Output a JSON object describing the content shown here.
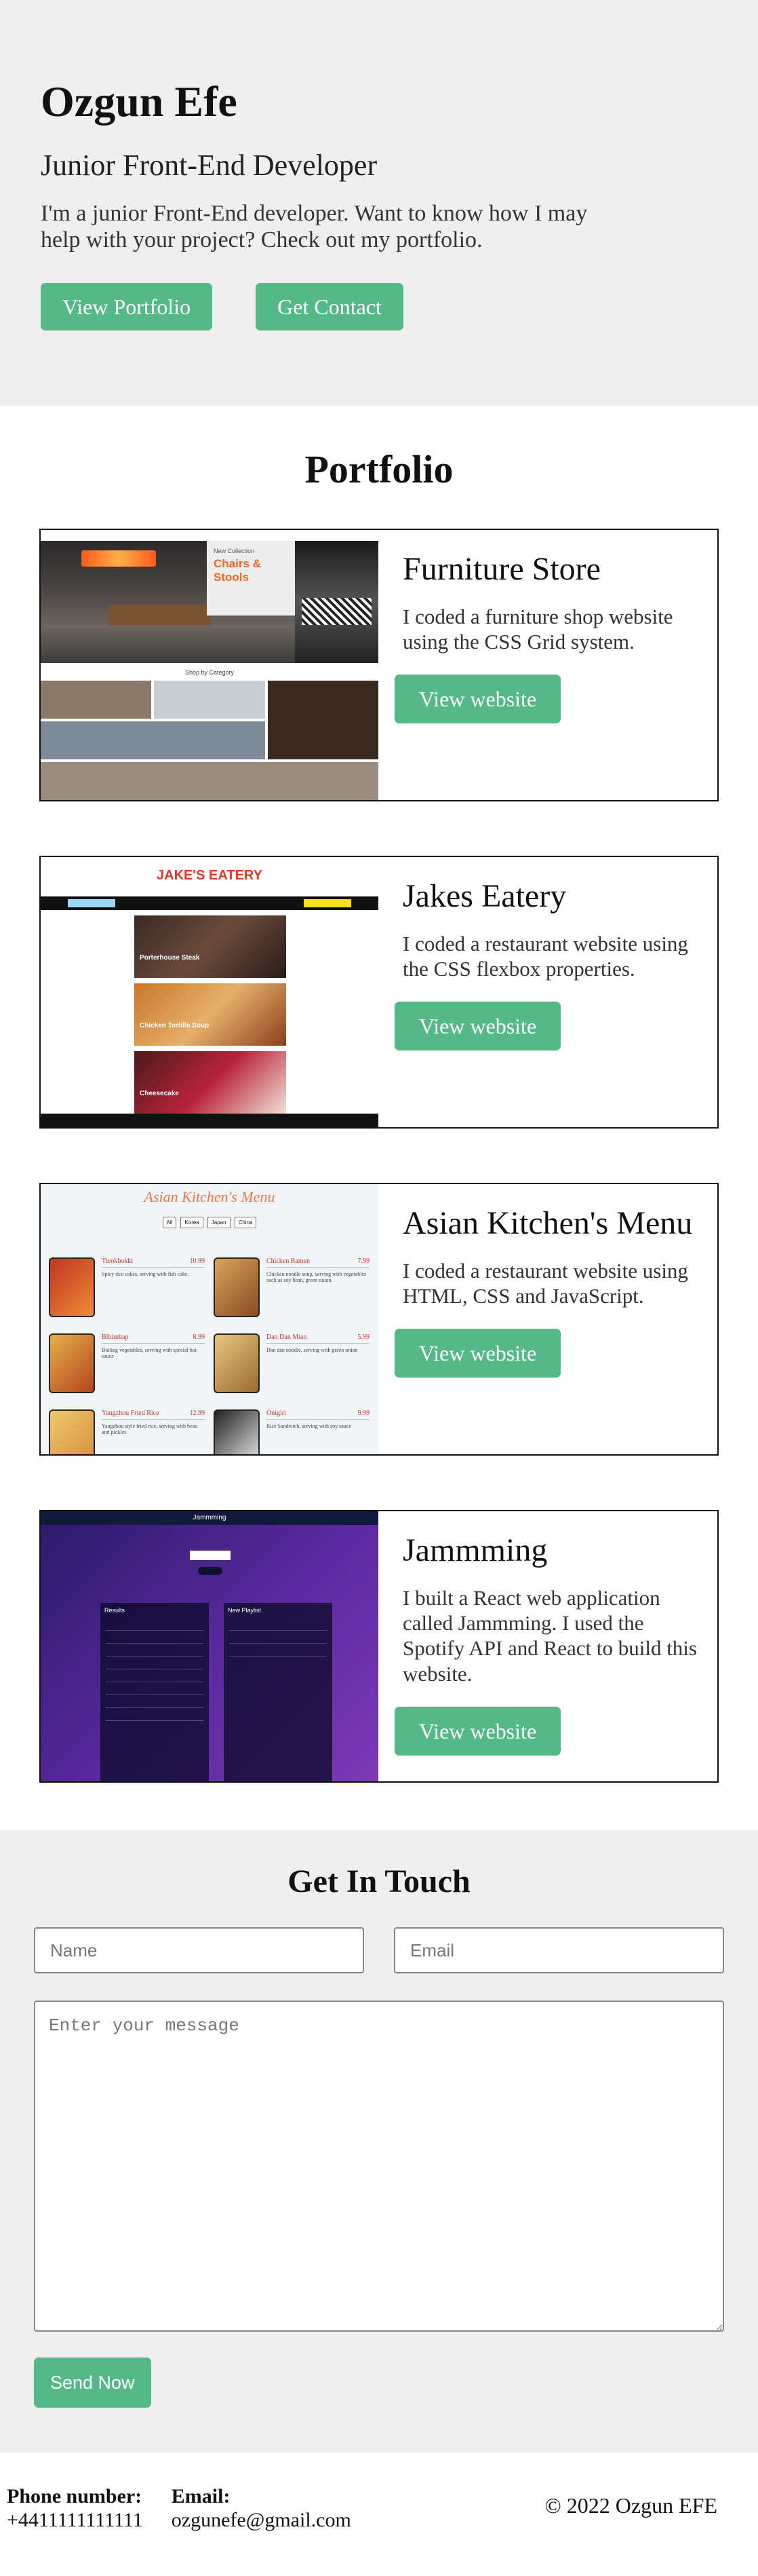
{
  "hero": {
    "name": "Ozgun Efe",
    "role": "Junior Front-End Developer",
    "intro": "I'm a junior Front-End developer. Want to know how I may help with your project? Check out my portfolio.",
    "view_portfolio_label": "View Portfolio",
    "get_contact_label": "Get Contact"
  },
  "portfolio": {
    "title": "Portfolio",
    "projects": [
      {
        "title": "Furniture Store",
        "description": "I coded a furniture shop website using the CSS Grid system.",
        "button_label": "View website",
        "thumb": {
          "collection": "New Collection",
          "headline": "Chairs & Stools",
          "caption": "Shop by Category"
        }
      },
      {
        "title": "Jakes Eatery",
        "description": "I coded a restaurant website using the CSS flexbox properties.",
        "button_label": "View website",
        "thumb": {
          "logo": "JAKE'S EATERY",
          "dishes": [
            "Porterhouse Steak",
            "Chicken Tortilla Soup",
            "Cheesecake"
          ]
        }
      },
      {
        "title": "Asian Kitchen's Menu",
        "description": "I coded a restaurant website using HTML, CSS and JavaScript.",
        "button_label": "View website",
        "thumb": {
          "title": "Asian Kitchen's Menu",
          "filters": [
            "All",
            "Korea",
            "Japan",
            "China"
          ],
          "items": [
            {
              "name": "Tteokbokki",
              "price": "10.99",
              "desc": "Spicy rice cakes, serving with fish cake."
            },
            {
              "name": "Chicken Ramen",
              "price": "7.99",
              "desc": "Chicken noodle soup, serving with vegetables such as soy bean, green onion."
            },
            {
              "name": "Bibimbap",
              "price": "8.99",
              "desc": "Boiling vegetables, serving with special hot sauce"
            },
            {
              "name": "Dan Dan Mian",
              "price": "5.99",
              "desc": "Dan dan noodle, serving with green onion"
            },
            {
              "name": "Yangzhou Fried Rice",
              "price": "12.99",
              "desc": "Yangzhou style fried rice, serving with bean and pickles"
            },
            {
              "name": "Onigiri",
              "price": "9.99",
              "desc": "Rice Sandwich, serving with soy sauce"
            }
          ]
        }
      },
      {
        "title": "Jammming",
        "description": "I built a React web application called Jammming. I used the Spotify API and React to build this website.",
        "button_label": "View website",
        "thumb": {
          "logo": "Jammming",
          "results": "Results",
          "playlist": "New Playlist"
        }
      }
    ]
  },
  "contact": {
    "title": "Get In Touch",
    "name_placeholder": "Name",
    "email_placeholder": "Email",
    "message_placeholder": "Enter your message",
    "send_label": "Send Now"
  },
  "footer": {
    "phone_label": "Phone number:",
    "phone_value": "+4411111111111",
    "email_label": "Email:",
    "email_value": "ozgunefe@gmail.com",
    "copyright": "© 2022 Ozgun EFE"
  },
  "colors": {
    "accent": "#55b987",
    "section_bg": "#efefef"
  }
}
